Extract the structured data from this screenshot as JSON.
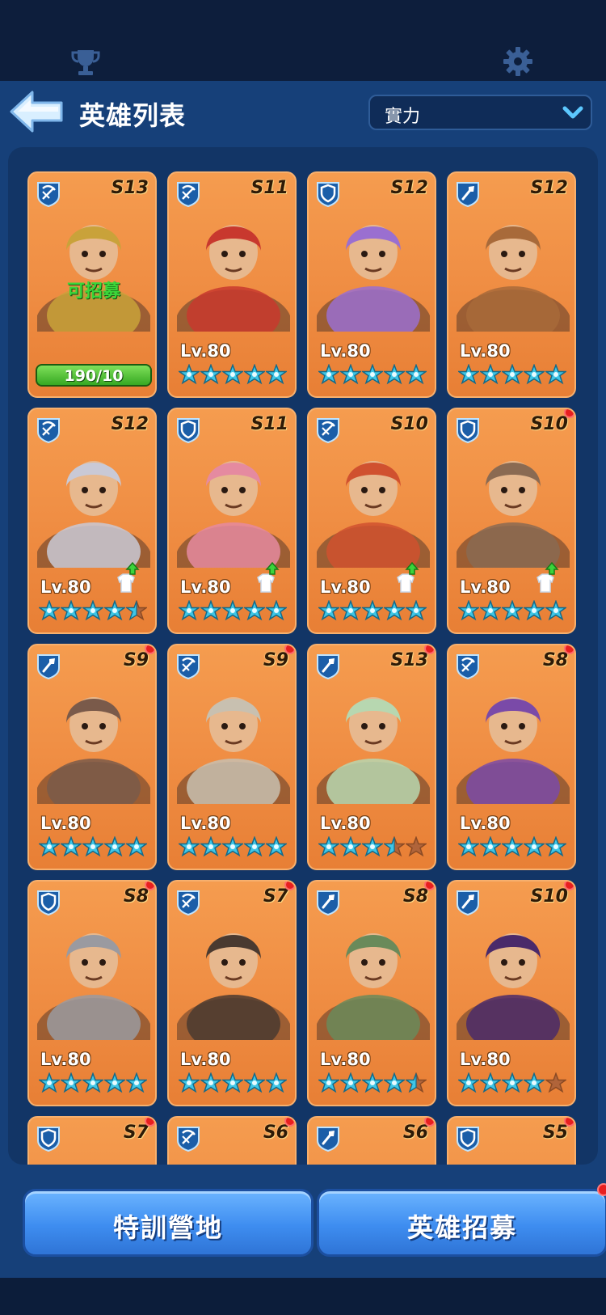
{
  "header": {
    "title": "英雄列表",
    "sort_label": "實力"
  },
  "top_icons": [
    "trophy-icon",
    "gear-icon"
  ],
  "heroes": [
    {
      "role": "crossbow",
      "grade": "S13",
      "level": "",
      "stars": 0,
      "recruitable": true,
      "recruit_text": "可招募",
      "progress": "190/10",
      "progress_fraction": 1.0,
      "dot": false,
      "upgrade": false
    },
    {
      "role": "crossbow",
      "grade": "S11",
      "level": "Lv.80",
      "stars": 5,
      "dot": false,
      "upgrade": false
    },
    {
      "role": "shield",
      "grade": "S12",
      "level": "Lv.80",
      "stars": 5,
      "dot": false,
      "upgrade": false
    },
    {
      "role": "shovel",
      "grade": "S12",
      "level": "Lv.80",
      "stars": 5,
      "dot": false,
      "upgrade": false
    },
    {
      "role": "crossbow",
      "grade": "S12",
      "level": "Lv.80",
      "stars": 4.5,
      "dot": false,
      "upgrade": true
    },
    {
      "role": "shield",
      "grade": "S11",
      "level": "Lv.80",
      "stars": 5,
      "dot": false,
      "upgrade": true
    },
    {
      "role": "crossbow",
      "grade": "S10",
      "level": "Lv.80",
      "stars": 5,
      "dot": false,
      "upgrade": true
    },
    {
      "role": "shield",
      "grade": "S10",
      "level": "Lv.80",
      "stars": 5,
      "dot": true,
      "upgrade": true
    },
    {
      "role": "shovel",
      "grade": "S9",
      "level": "Lv.80",
      "stars": 5,
      "dot": true,
      "upgrade": false
    },
    {
      "role": "crossbow",
      "grade": "S9",
      "level": "Lv.80",
      "stars": 5,
      "dot": true,
      "upgrade": false
    },
    {
      "role": "shovel",
      "grade": "S13",
      "level": "Lv.80",
      "stars": 3.5,
      "dot": true,
      "upgrade": false
    },
    {
      "role": "crossbow",
      "grade": "S8",
      "level": "Lv.80",
      "stars": 5,
      "dot": true,
      "upgrade": false
    },
    {
      "role": "shield",
      "grade": "S8",
      "level": "Lv.80",
      "stars": 5,
      "dot": true,
      "upgrade": false
    },
    {
      "role": "crossbow",
      "grade": "S7",
      "level": "Lv.80",
      "stars": 5,
      "dot": true,
      "upgrade": false
    },
    {
      "role": "shovel",
      "grade": "S8",
      "level": "Lv.80",
      "stars": 4.5,
      "dot": true,
      "upgrade": false
    },
    {
      "role": "shovel",
      "grade": "S10",
      "level": "Lv.80",
      "stars": 4,
      "dot": true,
      "upgrade": false
    },
    {
      "role": "shield",
      "grade": "S7",
      "level": "",
      "stars": 0,
      "dot": true,
      "upgrade": false
    },
    {
      "role": "crossbow",
      "grade": "S6",
      "level": "",
      "stars": 0,
      "dot": true,
      "upgrade": false
    },
    {
      "role": "shovel",
      "grade": "S6",
      "level": "",
      "stars": 0,
      "dot": true,
      "upgrade": false
    },
    {
      "role": "shield",
      "grade": "S5",
      "level": "",
      "stars": 0,
      "dot": true,
      "upgrade": false
    }
  ],
  "footer": {
    "left_button": "特訓營地",
    "right_button": "英雄招募",
    "right_button_dot": true
  },
  "colors": {
    "panel": "#164079",
    "card": "#f08f45",
    "star": "#3fc6e6",
    "button": "#3e8df0"
  }
}
